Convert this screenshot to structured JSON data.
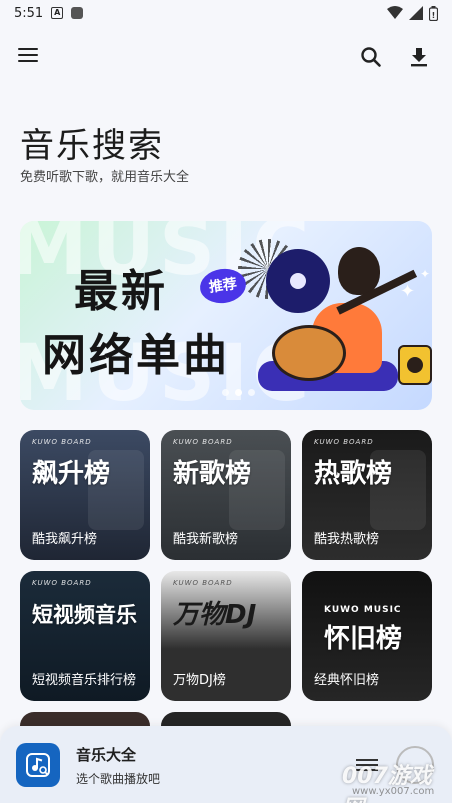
{
  "status_bar": {
    "time": "5:51"
  },
  "header": {
    "title": "音乐搜索",
    "subtitle": "免费听歌下歌，就用音乐大全"
  },
  "banner": {
    "bg_word": "MUSIC",
    "line1": "最新",
    "line2": "网络单曲",
    "tag": "推荐",
    "active_dot": 1
  },
  "cards": [
    {
      "board": "KUWO BOARD",
      "title": "飙升榜",
      "caption": "酷我飙升榜"
    },
    {
      "board": "KUWO BOARD",
      "title": "新歌榜",
      "caption": "酷我新歌榜"
    },
    {
      "board": "KUWO BOARD",
      "title": "热歌榜",
      "caption": "酷我热歌榜"
    },
    {
      "board": "KUWO BOARD",
      "title": "短视频音乐",
      "caption": "短视频音乐排行榜"
    },
    {
      "board": "KUWO BOARD",
      "title": "万物DJ",
      "caption": "万物DJ榜"
    },
    {
      "brand": "KUWO MUSIC",
      "title": "怀旧榜",
      "caption": "经典怀旧榜"
    }
  ],
  "player": {
    "song": "音乐大全",
    "hint": "选个歌曲播放吧"
  },
  "watermark": {
    "text": "007游戏网",
    "url": "www.yx007.com"
  },
  "colors": {
    "accent": "#1565c0",
    "tag": "#4a35e8",
    "background": "#f6f7fb"
  }
}
